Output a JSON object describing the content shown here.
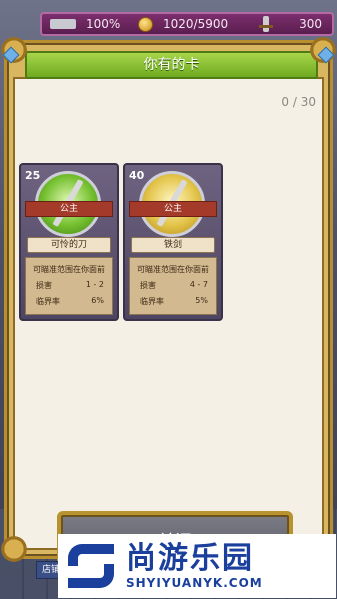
{
  "topbar": {
    "percent": "100%",
    "gold": "1020/5900",
    "energy": "300"
  },
  "dialog": {
    "title": "你有的卡",
    "count": "0 / 30",
    "close_label": "关闭"
  },
  "cards": [
    {
      "cost": "25",
      "class": "公主",
      "name": "可怜的刀",
      "desc": "可瞄准范围在你面前",
      "damage_label": "损害",
      "damage": "1 - 2",
      "crit_label": "临界率",
      "crit": "6%",
      "orb_color": "#74c02f"
    },
    {
      "cost": "40",
      "class": "公主",
      "name": "铁剑",
      "desc": "可瞄准范围在你面前",
      "damage_label": "损害",
      "damage": "4 - 7",
      "crit_label": "临界率",
      "crit": "5%",
      "orb_color": "#e3c44a"
    }
  ],
  "bottom": {
    "shop_tab": "店铺"
  },
  "watermark": {
    "cn": "尚游乐园",
    "en": "SHYIYUANYK.COM"
  }
}
